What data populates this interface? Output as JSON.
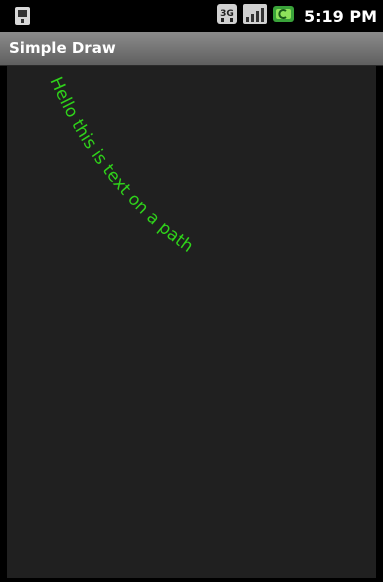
{
  "status_bar": {
    "time": "5:19 PM",
    "network_label": "3G",
    "icons": [
      "sim-notification-icon",
      "network-3g-icon",
      "signal-strength-icon",
      "battery-charging-icon"
    ]
  },
  "app": {
    "title": "Simple Draw"
  },
  "canvas": {
    "path_text": "Hello this is text on a path",
    "text_color": "#2fd21a",
    "background_color": "#202020"
  }
}
